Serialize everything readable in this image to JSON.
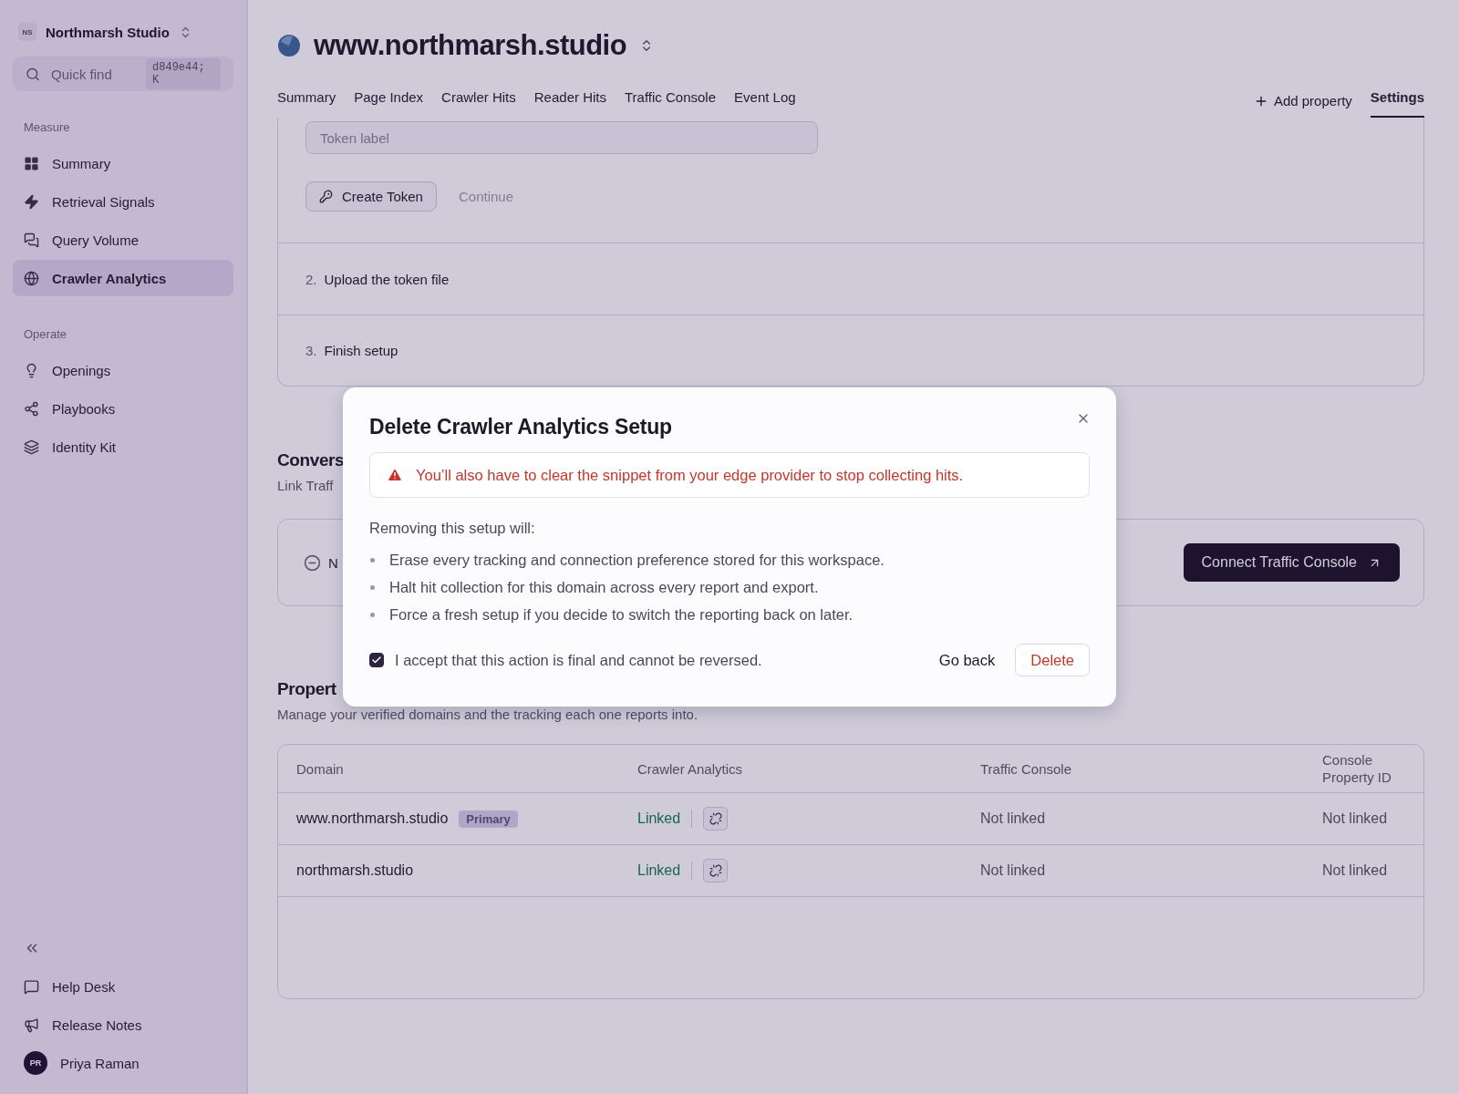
{
  "sidebar": {
    "workspace": {
      "initials": "NS",
      "name": "Northmarsh Studio"
    },
    "search": {
      "placeholder": "Quick find",
      "shortcut": "d849e44; K"
    },
    "sections": [
      {
        "title": "Measure",
        "items": [
          {
            "label": "Summary",
            "selected": false
          },
          {
            "label": "Retrieval Signals",
            "selected": false
          },
          {
            "label": "Query Volume",
            "selected": false
          },
          {
            "label": "Crawler Analytics",
            "selected": true
          }
        ]
      },
      {
        "title": "Operate",
        "items": [
          {
            "label": "Openings",
            "selected": false
          },
          {
            "label": "Playbooks",
            "selected": false
          },
          {
            "label": "Identity Kit",
            "selected": false
          }
        ]
      }
    ],
    "footer_items": [
      {
        "label": "Help Desk"
      },
      {
        "label": "Release Notes"
      }
    ],
    "user": {
      "initials": "PR",
      "name": "Priya Raman"
    }
  },
  "header": {
    "title": "www.northmarsh.studio",
    "tabs": [
      {
        "label": "Summary",
        "selected": false
      },
      {
        "label": "Page Index",
        "selected": false
      },
      {
        "label": "Crawler Hits",
        "selected": false
      },
      {
        "label": "Reader Hits",
        "selected": false
      },
      {
        "label": "Traffic Console",
        "selected": false
      },
      {
        "label": "Event Log",
        "selected": false
      }
    ],
    "add_property": "Add property",
    "settings_tab": {
      "label": "Settings",
      "selected": true
    }
  },
  "setup_steps": {
    "token_field": {
      "placeholder": "Token label"
    },
    "create_button": "Create Token",
    "continue_button": "Continue",
    "steps": [
      {
        "number": "2.",
        "label": "Upload the token file"
      },
      {
        "number": "3.",
        "label": "Finish setup"
      }
    ]
  },
  "conversion": {
    "title": "Convers",
    "subtitle": "Link Traff",
    "row_text": "N",
    "connect_button": "Connect Traffic Console"
  },
  "properties": {
    "title": "Propert",
    "subtitle": "Manage your verified domains and the tracking each one reports into.",
    "columns": [
      "Domain",
      "Crawler Analytics",
      "Traffic Console",
      "Console\nProperty ID"
    ],
    "rows": [
      {
        "domain": "www.northmarsh.studio",
        "badge": "Primary",
        "crawler_analytics": "Linked",
        "traffic_console": "Not linked",
        "console_property_id": "Not linked"
      },
      {
        "domain": "northmarsh.studio",
        "crawler_analytics": "Linked",
        "traffic_console": "Not linked",
        "console_property_id": "Not linked"
      }
    ]
  },
  "modal": {
    "title": "Delete Crawler Analytics Setup",
    "warning": "You’ll also have to clear the snippet from your edge provider to stop collecting hits.",
    "intro": "Removing this setup will:",
    "bullets": [
      "Erase every tracking and connection preference stored for this workspace.",
      "Halt hit collection for this domain across every report and export.",
      "Force a fresh setup if you decide to switch the reporting back on later."
    ],
    "accept": {
      "label": "I accept that this action is final and cannot be reversed.",
      "checked": true
    },
    "back_button": "Go back",
    "delete_button": "Delete"
  }
}
